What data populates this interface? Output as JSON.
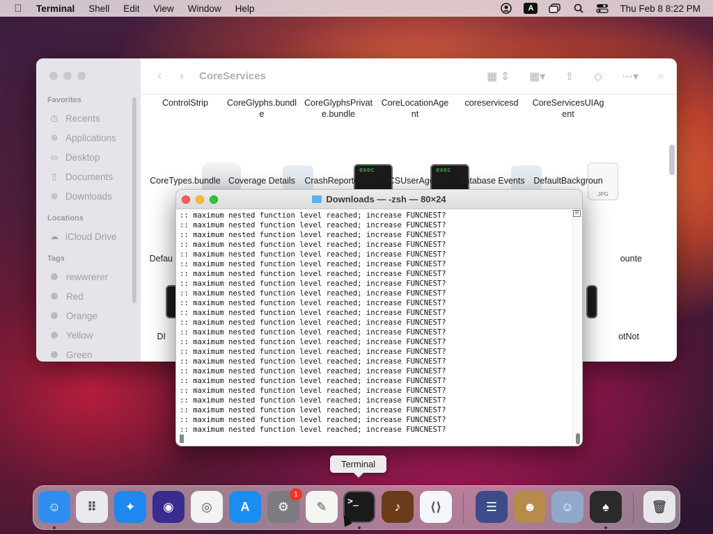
{
  "menubar": {
    "apple_icon": "apple-icon",
    "app_name": "Terminal",
    "items": [
      "Shell",
      "Edit",
      "View",
      "Window",
      "Help"
    ],
    "status": {
      "accessibility_label": "A",
      "datetime": "Thu Feb 8  8:22 PM"
    }
  },
  "finder": {
    "title": "CoreServices",
    "sidebar": {
      "favorites_header": "Favorites",
      "favorites": [
        "Recents",
        "Applications",
        "Desktop",
        "Documents",
        "Downloads"
      ],
      "locations_header": "Locations",
      "locations": [
        "iCloud Drive"
      ],
      "tags_header": "Tags",
      "tags": [
        "rewwrerer",
        "Red",
        "Orange",
        "Yellow",
        "Green"
      ]
    },
    "files_row1": [
      "ControlStrip",
      "CoreGlyphs.bundl\ne",
      "CoreGlyphsPrivat\ne.bundle",
      "CoreLocationAge\nnt",
      "coreservicesd",
      "CoreServicesUIAg\nent"
    ],
    "files_row2": [
      "CoreTypes.bundle",
      "Coverage Details",
      "CrashReporterSu",
      "CSUserAgent",
      "Database Events",
      "DefaultBackgroun"
    ],
    "files_row3_partial": [
      "Defau",
      "ounte"
    ],
    "files_row4_partial": [
      "DI",
      "otNot"
    ],
    "exec_label": "exec",
    "jpg_label": "JPG"
  },
  "terminal": {
    "title": "Downloads — -zsh — 80×24",
    "lines": [
      ":: maximum nested function level reached; increase FUNCNEST?",
      ":: maximum nested function level reached; increase FUNCNEST?",
      ":: maximum nested function level reached; increase FUNCNEST?",
      ":: maximum nested function level reached; increase FUNCNEST?",
      ":: maximum nested function level reached; increase FUNCNEST?",
      ":: maximum nested function level reached; increase FUNCNEST?",
      ":: maximum nested function level reached; increase FUNCNEST?",
      ":: maximum nested function level reached; increase FUNCNEST?",
      ":: maximum nested function level reached; increase FUNCNEST?",
      ":: maximum nested function level reached; increase FUNCNEST?",
      ":: maximum nested function level reached; increase FUNCNEST?",
      ":: maximum nested function level reached; increase FUNCNEST?",
      ":: maximum nested function level reached; increase FUNCNEST?",
      ":: maximum nested function level reached; increase FUNCNEST?",
      ":: maximum nested function level reached; increase FUNCNEST?",
      ":: maximum nested function level reached; increase FUNCNEST?",
      ":: maximum nested function level reached; increase FUNCNEST?",
      ":: maximum nested function level reached; increase FUNCNEST?",
      ":: maximum nested function level reached; increase FUNCNEST?",
      ":: maximum nested function level reached; increase FUNCNEST?",
      ":: maximum nested function level reached; increase FUNCNEST?",
      ":: maximum nested function level reached; increase FUNCNEST?",
      ":: maximum nested function level reached; increase FUNCNEST?"
    ]
  },
  "tooltip": "Terminal",
  "dock": {
    "settings_badge": "1",
    "terminal_glyph": ">_",
    "items": [
      {
        "name": "finder-dock-icon",
        "color": "#2f8df0",
        "glyph": "☺"
      },
      {
        "name": "launchpad-dock-icon",
        "color": "#e9e9ee",
        "glyph": "⠿"
      },
      {
        "name": "safari-dock-icon",
        "color": "#1e88f0",
        "glyph": "✦"
      },
      {
        "name": "firefox-dock-icon",
        "color": "#3a2b8f",
        "glyph": "◉"
      },
      {
        "name": "chrome-dock-icon",
        "color": "#f3f3f3",
        "glyph": "◎"
      },
      {
        "name": "app-store-dock-icon",
        "color": "#1b8cf2",
        "glyph": "A"
      },
      {
        "name": "system-settings-dock-icon",
        "color": "#7b7b80",
        "glyph": "⚙"
      },
      {
        "name": "textedit-dock-icon",
        "color": "#f5f5f2",
        "glyph": "✎"
      },
      {
        "name": "terminal-dock-icon",
        "color": "#1a1a1a",
        "glyph": ""
      },
      {
        "name": "instruments-dock-icon",
        "color": "#6b3b1a",
        "glyph": "♪"
      },
      {
        "name": "vscode-dock-icon",
        "color": "#f4f6fa",
        "glyph": "⟨⟩"
      },
      {
        "name": "automator-dock-icon",
        "color": "#3b4c8a",
        "glyph": "☰"
      },
      {
        "name": "contacts-dock-icon",
        "color": "#b78b4a",
        "glyph": "☻"
      },
      {
        "name": "migration-dock-icon",
        "color": "#8fa8cc",
        "glyph": "☺"
      },
      {
        "name": "bartender-dock-icon",
        "color": "#2a2a2a",
        "glyph": "♠"
      },
      {
        "name": "trash-dock-icon",
        "color": "#e8e8ec",
        "glyph": "🗑"
      }
    ]
  }
}
